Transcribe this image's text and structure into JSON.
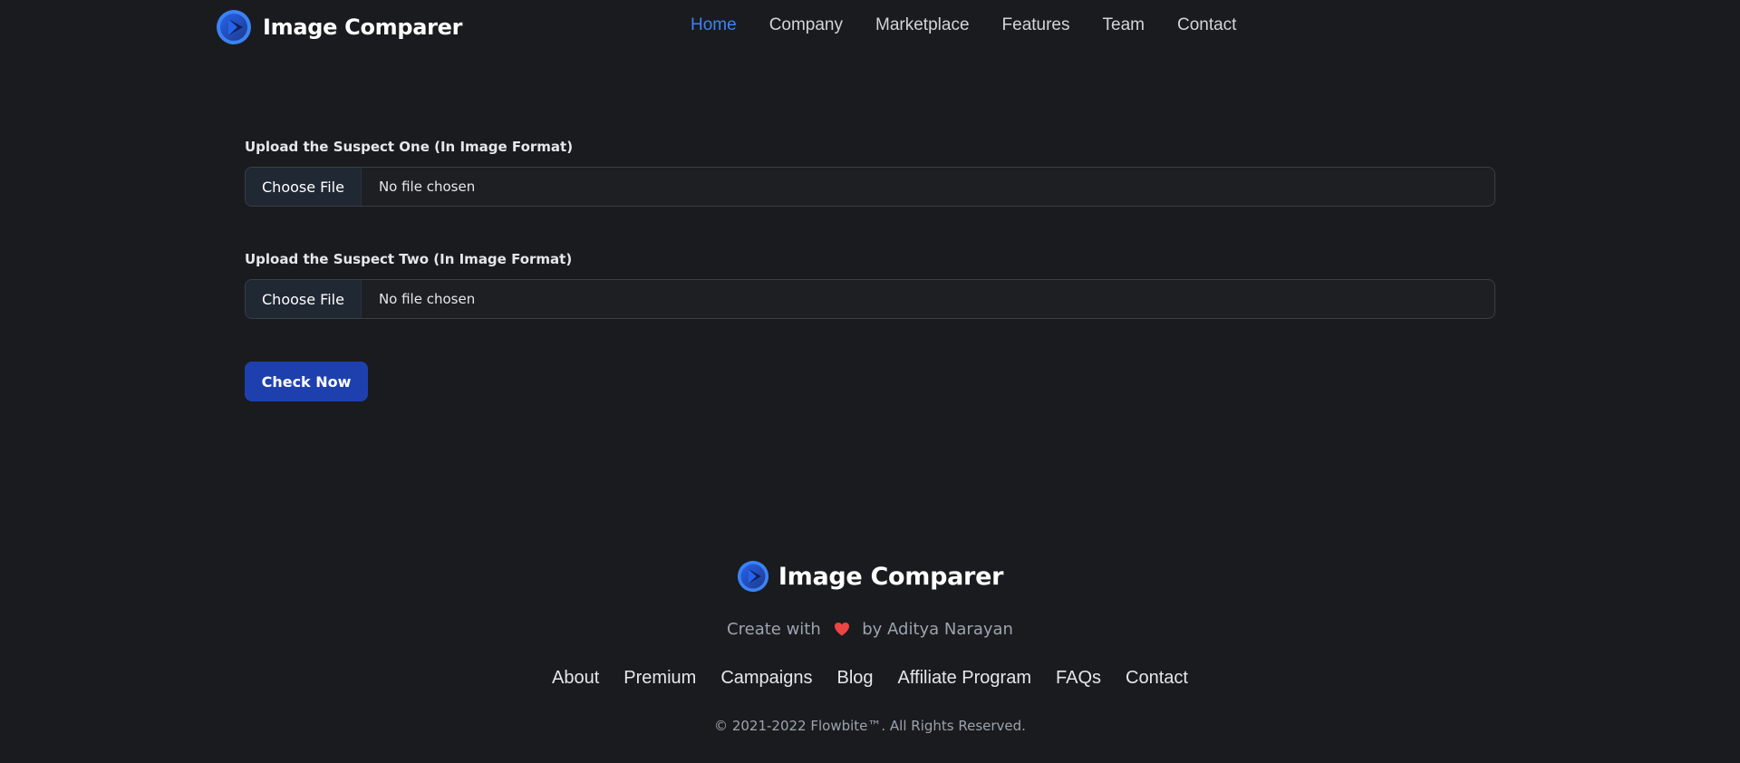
{
  "header": {
    "brand_name": "Image Comparer",
    "logo_icon": "play-circle-logo",
    "nav": [
      "Home",
      "Company",
      "Marketplace",
      "Features",
      "Team",
      "Contact"
    ],
    "active_nav": "Home"
  },
  "form": {
    "suspect_one": {
      "label": "Upload the Suspect One (In Image Format)",
      "button_label": "Choose File",
      "status": "No file chosen"
    },
    "suspect_two": {
      "label": "Upload the Suspect Two (In Image Format)",
      "button_label": "Choose File",
      "status": "No file chosen"
    },
    "submit_label": "Check Now"
  },
  "footer": {
    "brand_name": "Image Comparer",
    "tagline_prefix": "Create with",
    "tagline_icon": "heart-icon",
    "tagline_suffix": "by Aditya Narayan",
    "links": [
      "About",
      "Premium",
      "Campaigns",
      "Blog",
      "Affiliate Program",
      "FAQs",
      "Contact"
    ],
    "copyright": "© 2021-2022 Flowbite™. All Rights Reserved."
  },
  "colors": {
    "background": "#1a1b1e",
    "accent": "#3b82f6",
    "button": "#1e40af",
    "heart": "#ef4444"
  }
}
